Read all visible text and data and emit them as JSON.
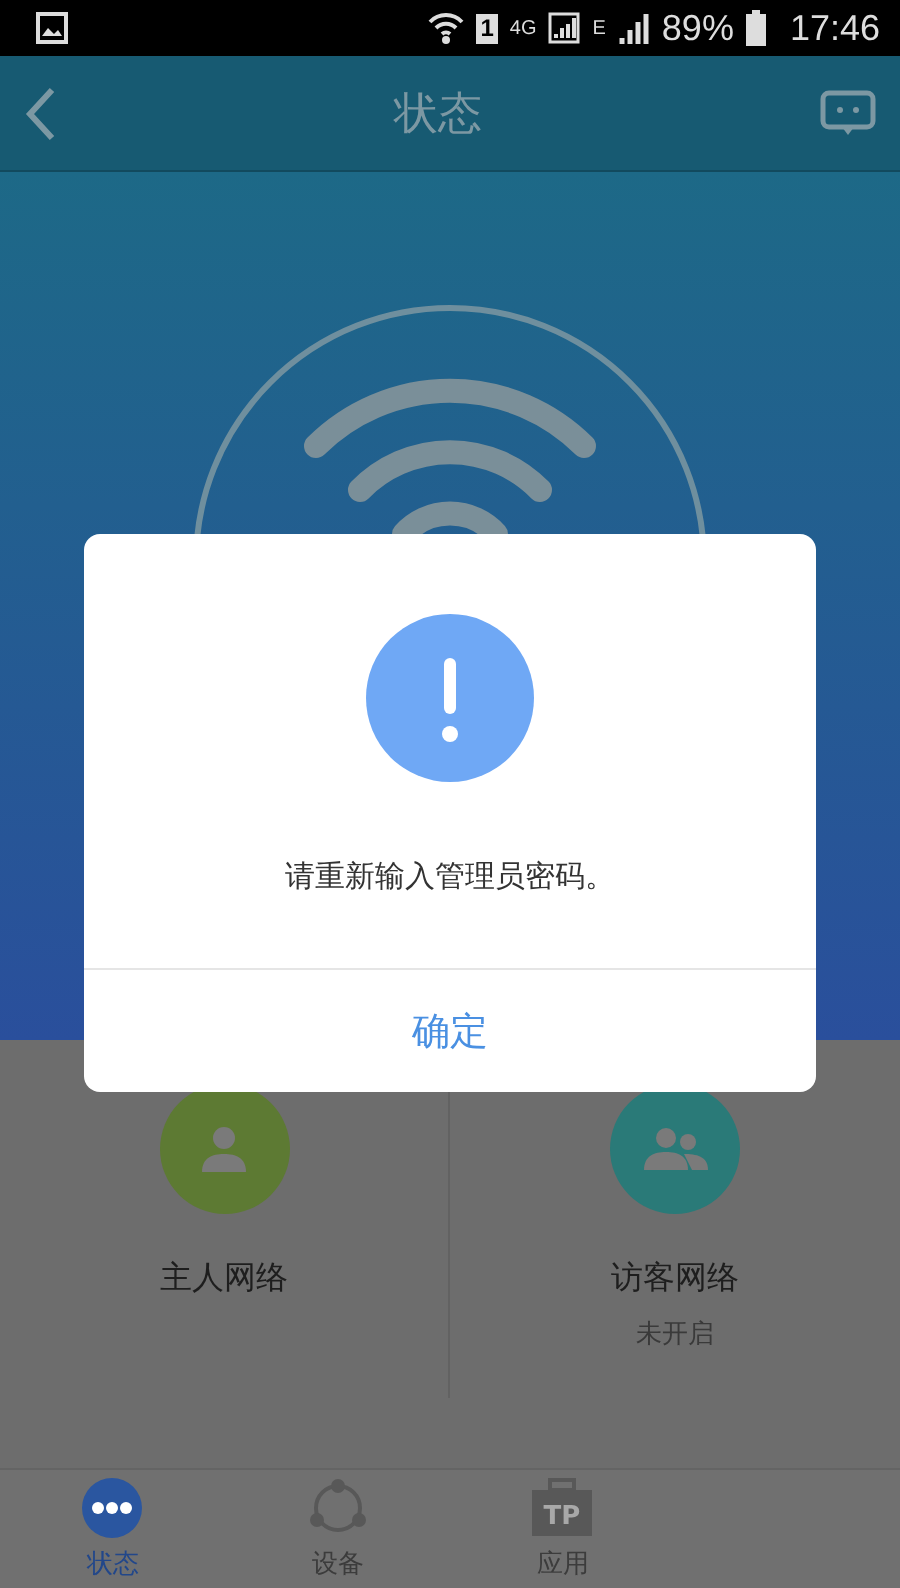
{
  "status_bar": {
    "sim": "1",
    "network_1": "4G",
    "network_2": "E",
    "battery": "89%",
    "time": "17:46"
  },
  "header": {
    "title": "状态"
  },
  "networks": [
    {
      "kind": "host",
      "label": "主人网络",
      "color": "#5d7a33"
    },
    {
      "kind": "guest",
      "label": "访客网络",
      "status": "未开启",
      "color": "#2a7a78"
    }
  ],
  "tabs": [
    {
      "kind": "status",
      "label": "状态",
      "selected": true
    },
    {
      "kind": "devices",
      "label": "设备",
      "selected": false
    },
    {
      "kind": "apps",
      "label": "应用",
      "badge": "TP",
      "selected": false
    }
  ],
  "dialog": {
    "message": "请重新输入管理员密码。",
    "button": "确定"
  }
}
